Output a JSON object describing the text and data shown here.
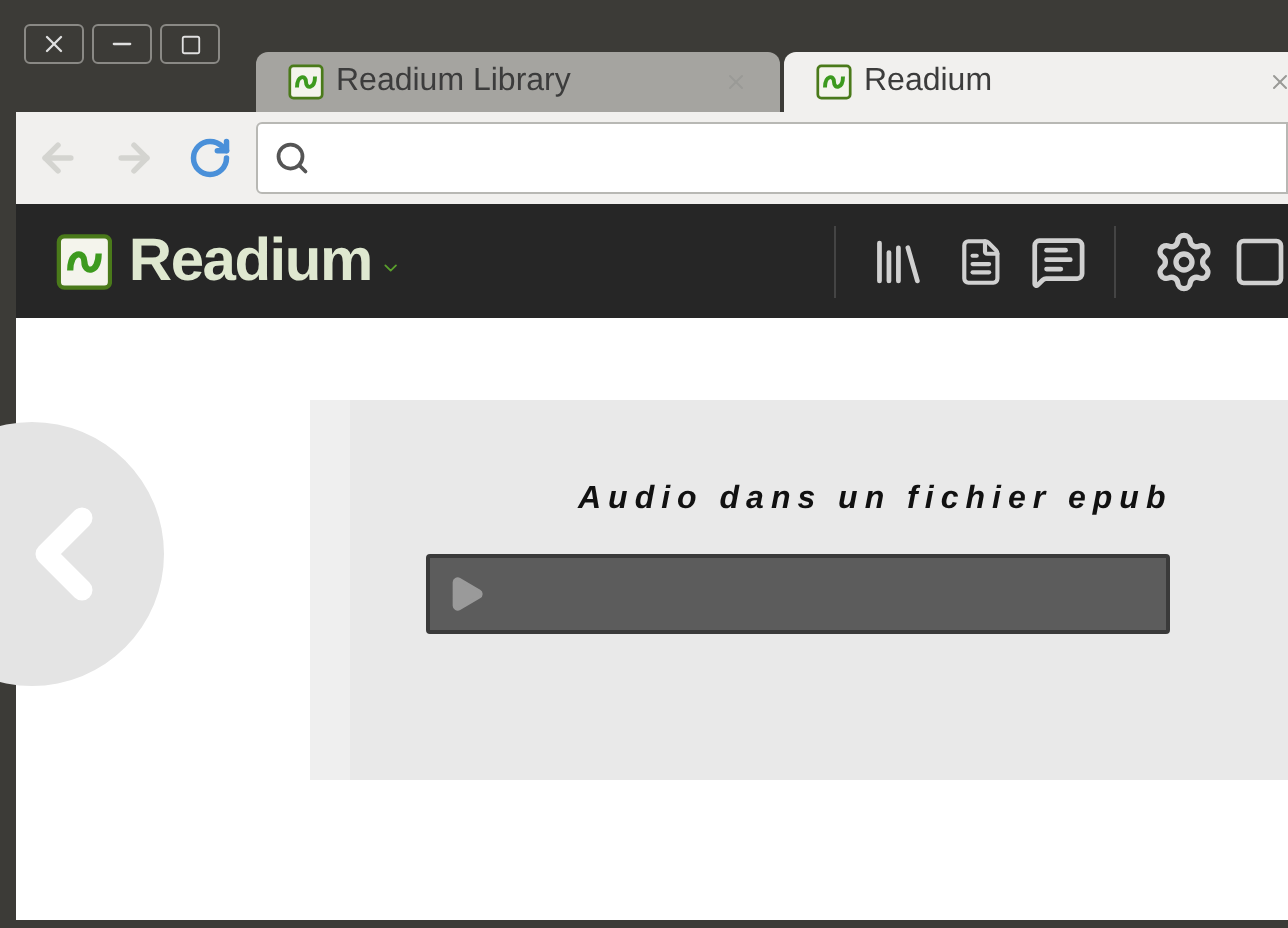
{
  "tabs": [
    {
      "label": "Readium Library",
      "selected": false
    },
    {
      "label": "Readium",
      "selected": true
    }
  ],
  "app_bar": {
    "brand": "Readium"
  },
  "content": {
    "title": "Audio dans un fichier epub"
  }
}
